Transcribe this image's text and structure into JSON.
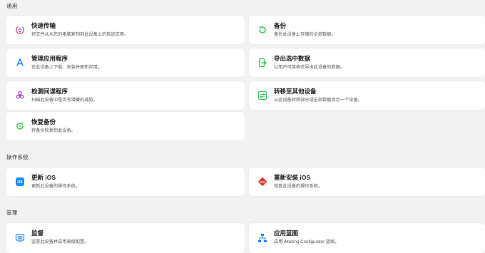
{
  "sections": {
    "general": "通用",
    "os": "操作系统",
    "manage": "管理"
  },
  "cards": {
    "quick_transfer": {
      "title": "快速传输",
      "desc": "将文件从从您的电脑复制到此设备上的指定应用。",
      "icon": "quick-transfer-icon"
    },
    "backup": {
      "title": "备份",
      "desc": "备份此设备上存储的全部数据。",
      "icon": "backup-icon"
    },
    "manage_apps": {
      "title": "管理应用程序",
      "desc": "在此设备上下载、安装并更新应用。",
      "icon": "app-store-icon"
    },
    "export_data": {
      "title": "导出选中数据",
      "desc": "以用户可读格式导出此设备的数据。",
      "icon": "export-icon"
    },
    "spyware_check": {
      "title": "检测间谍程序",
      "desc": "扫描此设备中是否有潜藏的威胁。",
      "icon": "biohazard-icon"
    },
    "transfer_device": {
      "title": "转移至其他设备",
      "desc": "从此设备转移部分或全部数据到另一个设备。",
      "icon": "transfer-icon"
    },
    "restore_backup": {
      "title": "恢复备份",
      "desc": "将备份恢复到此设备。",
      "icon": "restore-icon"
    },
    "update_ios": {
      "title": "更新 iOS",
      "desc": "更新此设备的操作系统。",
      "icon": "ios-update-icon"
    },
    "reinstall_ios": {
      "title": "重新安装 iOS",
      "desc": "恢复此设备的操作系统。",
      "icon": "ios-reinstall-icon"
    },
    "supervise": {
      "title": "监督",
      "desc": "监督此设备并应用高级配置。",
      "icon": "supervise-icon"
    },
    "blueprint": {
      "title": "应用蓝图",
      "desc": "应用 iMazing Configurator 蓝图。",
      "icon": "blueprint-icon"
    }
  },
  "colors": {
    "background": "#f2f2f4",
    "card": "#ffffff",
    "green": "#34c759",
    "blue": "#1a8cff",
    "red": "#e5322d",
    "purple": "#a03cc8"
  }
}
